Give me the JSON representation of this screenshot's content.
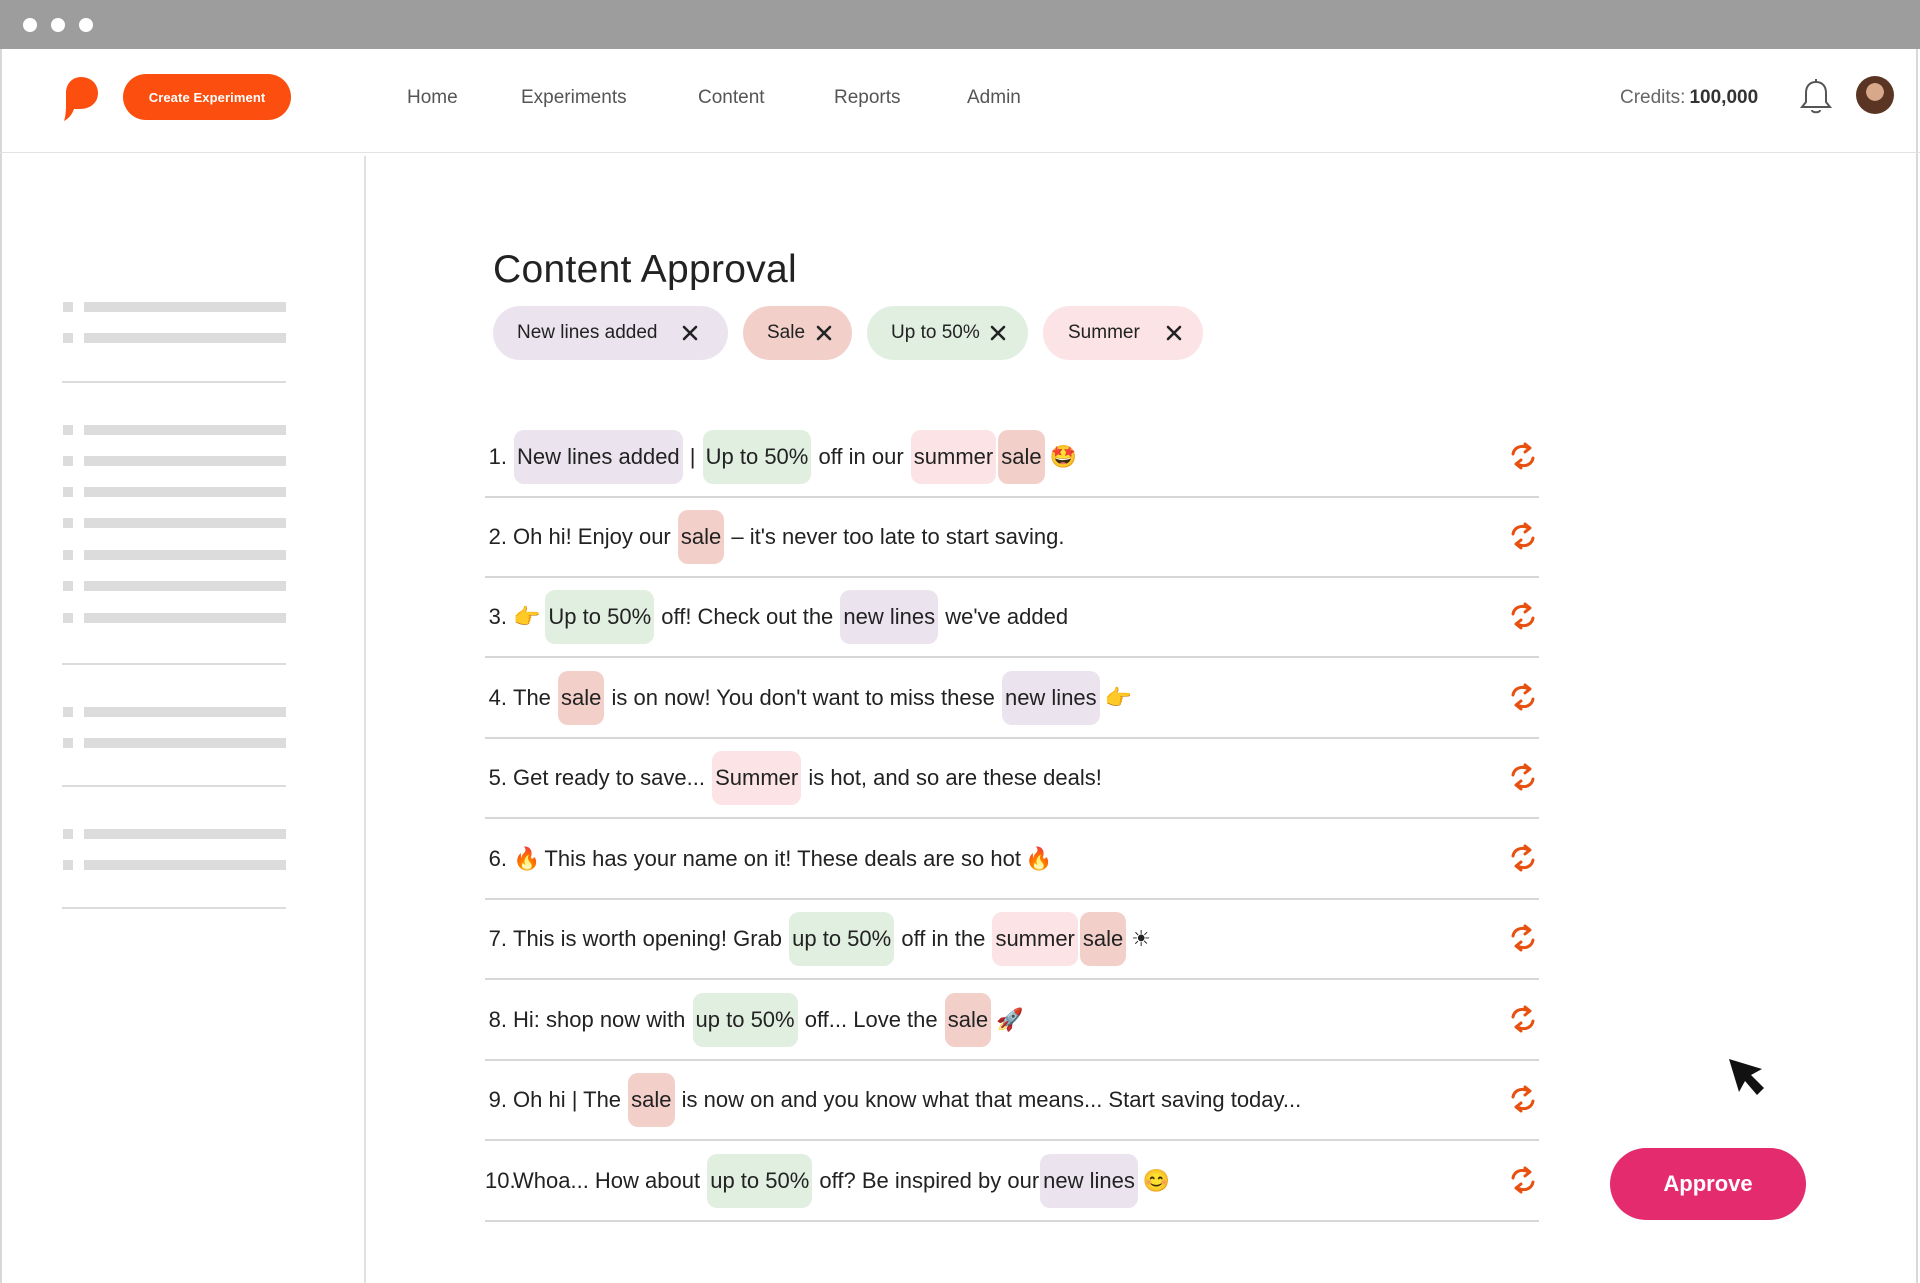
{
  "header": {
    "create_button": "Create Experiment",
    "nav": [
      "Home",
      "Experiments",
      "Content",
      "Reports",
      "Admin"
    ],
    "credits_label": "Credits:",
    "credits_value": "100,000"
  },
  "page": {
    "title": "Content Approval",
    "filters": [
      "New lines added",
      "Sale",
      "Up to 50%",
      "Summer"
    ],
    "approve_button": "Approve"
  },
  "colors": {
    "brand_orange": "#fc4f0f",
    "approve_pink": "#e42b6d",
    "tag_new_lines": "#ebe4ef",
    "tag_sale": "#f3cfca",
    "tag_up_to_50": "#e1efe1",
    "tag_summer": "#fbe3e6"
  },
  "lines": [
    {
      "num": "1.",
      "segments": [
        {
          "text": "New lines added",
          "hl": "purple"
        },
        {
          "text": " | "
        },
        {
          "text": "Up to 50%",
          "hl": "green"
        },
        {
          "text": " off in our "
        },
        {
          "text": "summer",
          "hl": "pink"
        },
        {
          "text": "sale",
          "hl": "red"
        }
      ],
      "emoji": "🤩"
    },
    {
      "num": "2.",
      "segments": [
        {
          "text": "Oh hi! Enjoy our "
        },
        {
          "text": "sale",
          "hl": "red"
        },
        {
          "text": " – it's never too late to start saving."
        }
      ],
      "emoji": ""
    },
    {
      "num": "3.",
      "lead_emoji": "👉",
      "segments": [
        {
          "text": "Up to 50%",
          "hl": "green"
        },
        {
          "text": " off! Check out the "
        },
        {
          "text": "new lines",
          "hl": "purple"
        },
        {
          "text": " we've added"
        }
      ],
      "emoji": ""
    },
    {
      "num": "4.",
      "segments": [
        {
          "text": "The "
        },
        {
          "text": "sale",
          "hl": "red"
        },
        {
          "text": " is on now! You don't want to miss these "
        },
        {
          "text": "new lines",
          "hl": "purple"
        }
      ],
      "emoji": "👉"
    },
    {
      "num": "5.",
      "segments": [
        {
          "text": "Get ready to save... "
        },
        {
          "text": "Summer",
          "hl": "pink"
        },
        {
          "text": " is hot, and so are these deals!"
        }
      ],
      "emoji": ""
    },
    {
      "num": "6.",
      "lead_emoji": "🔥",
      "segments": [
        {
          "text": "This has your name on it! These deals are so hot"
        }
      ],
      "emoji": "🔥"
    },
    {
      "num": "7.",
      "segments": [
        {
          "text": "This is worth opening! Grab "
        },
        {
          "text": "up to 50%",
          "hl": "green"
        },
        {
          "text": " off in the "
        },
        {
          "text": "summer",
          "hl": "pink"
        },
        {
          "text": "sale",
          "hl": "red"
        }
      ],
      "emoji": "☀"
    },
    {
      "num": "8.",
      "segments": [
        {
          "text": "Hi: shop now with "
        },
        {
          "text": "up to 50%",
          "hl": "green"
        },
        {
          "text": " off... Love the "
        },
        {
          "text": "sale",
          "hl": "red"
        }
      ],
      "emoji": "🚀"
    },
    {
      "num": "9.",
      "segments": [
        {
          "text": "Oh hi | The "
        },
        {
          "text": "sale",
          "hl": "red"
        },
        {
          "text": " is now on and you know what that means... Start saving today..."
        }
      ],
      "emoji": ""
    },
    {
      "num": "10.",
      "segments": [
        {
          "text": "Whoa... How about "
        },
        {
          "text": "up to 50%",
          "hl": "green"
        },
        {
          "text": " off? Be inspired by our"
        },
        {
          "text": "new lines",
          "hl": "purple"
        }
      ],
      "emoji": "😊"
    }
  ]
}
